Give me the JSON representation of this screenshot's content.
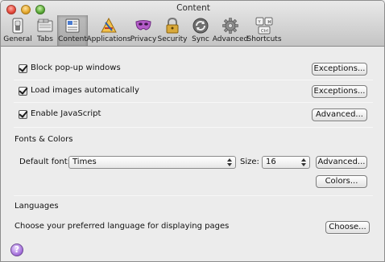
{
  "window": {
    "title": "Content"
  },
  "toolbar": {
    "tabs": [
      {
        "label": "General",
        "icon": "switch-icon"
      },
      {
        "label": "Tabs",
        "icon": "tabs-icon"
      },
      {
        "label": "Content",
        "icon": "content-icon",
        "selected": true
      },
      {
        "label": "Applications",
        "icon": "applications-icon"
      },
      {
        "label": "Privacy",
        "icon": "mask-icon"
      },
      {
        "label": "Security",
        "icon": "lock-icon"
      },
      {
        "label": "Sync",
        "icon": "sync-icon"
      },
      {
        "label": "Advanced",
        "icon": "gear-icon"
      },
      {
        "label": "Shortcuts",
        "icon": "keyboard-icon"
      }
    ]
  },
  "content": {
    "options": [
      {
        "label": "Block pop-up windows",
        "checked": true,
        "button": "Exceptions..."
      },
      {
        "label": "Load images automatically",
        "checked": true,
        "button": "Exceptions..."
      },
      {
        "label": "Enable JavaScript",
        "checked": true,
        "button": "Advanced..."
      }
    ],
    "fonts": {
      "section_title": "Fonts & Colors",
      "default_font_label": "Default font:",
      "default_font_value": "Times",
      "size_label": "Size:",
      "size_value": "16",
      "advanced_button": "Advanced...",
      "colors_button": "Colors..."
    },
    "languages": {
      "section_title": "Languages",
      "description": "Choose your preferred language for displaying pages",
      "choose_button": "Choose..."
    },
    "help_label": "?"
  }
}
